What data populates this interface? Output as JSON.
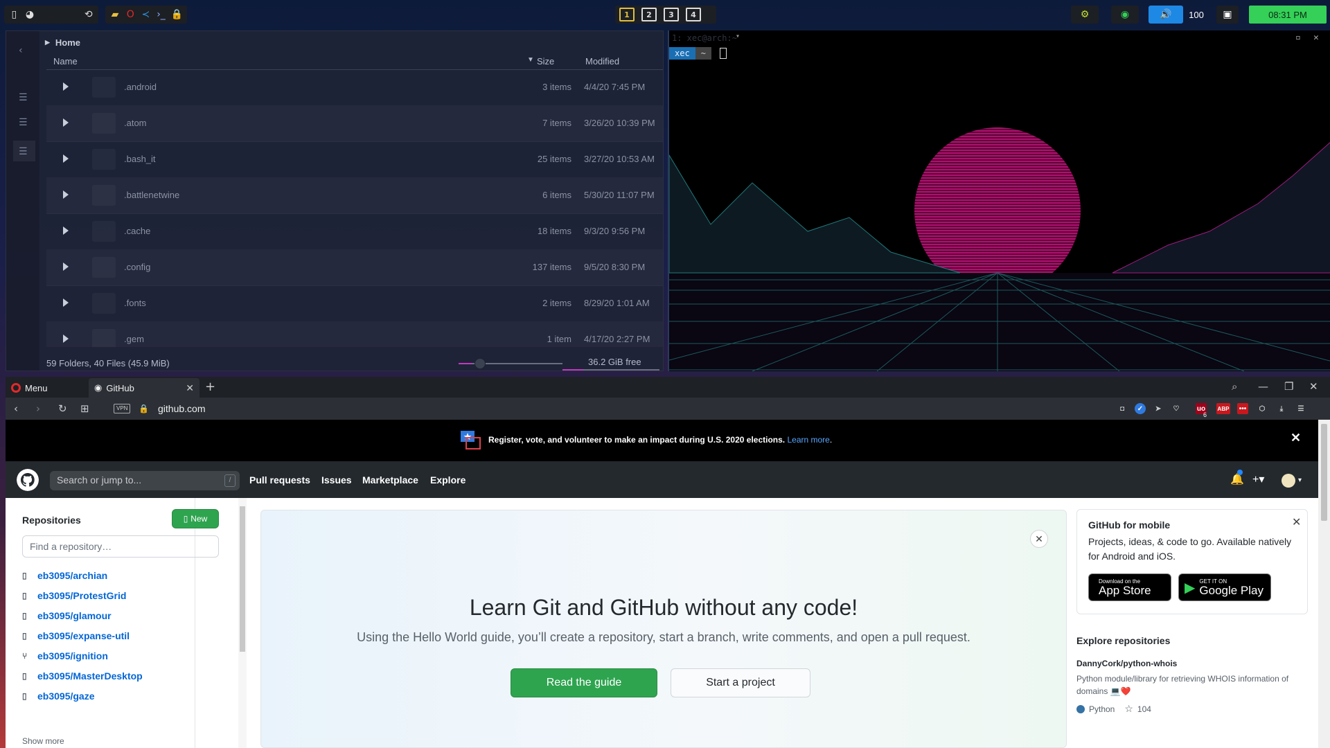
{
  "topbar": {
    "workspaces": [
      "1",
      "2",
      "3",
      "4"
    ],
    "volume": "100",
    "clock": "08:31 PM",
    "icons": [
      "notes-icon",
      "discord-icon",
      "sync-icon",
      "folder-icon",
      "opera-icon",
      "vscode-icon",
      "terminal-icon",
      "lock-icon",
      "cpu-icon",
      "gpu-icon",
      "volume-icon",
      "display-icon"
    ]
  },
  "file_manager": {
    "breadcrumb": "Home",
    "columns": {
      "name": "Name",
      "size": "Size",
      "modified": "Modified"
    },
    "rows": [
      {
        "name": ".android",
        "size": "3 items",
        "modified": "4/4/20 7:45 PM"
      },
      {
        "name": ".atom",
        "size": "7 items",
        "modified": "3/26/20 10:39 PM"
      },
      {
        "name": ".bash_it",
        "size": "25 items",
        "modified": "3/27/20 10:53 AM"
      },
      {
        "name": ".battlenetwine",
        "size": "6 items",
        "modified": "5/30/20 11:07 PM"
      },
      {
        "name": ".cache",
        "size": "18 items",
        "modified": "9/3/20 9:56 PM"
      },
      {
        "name": ".config",
        "size": "137 items",
        "modified": "9/5/20 8:30 PM"
      },
      {
        "name": ".fonts",
        "size": "2 items",
        "modified": "8/29/20 1:01 AM"
      },
      {
        "name": ".gem",
        "size": "1 item",
        "modified": "4/17/20 2:27 PM"
      }
    ],
    "status": "59 Folders, 40 Files (45.9 MiB)",
    "free_space": "36.2 GiB free"
  },
  "terminal": {
    "title": "1: xec@arch:~",
    "user": "xec",
    "dir": "~"
  },
  "browser": {
    "menu_label": "Menu",
    "tab_title": "GitHub",
    "url": "github.com",
    "vpn_label": "VPN",
    "ext_badge": "6",
    "ext_abp": "ABP"
  },
  "github": {
    "banner_text": "Register, vote, and volunteer to make an impact during U.S. 2020 elections.",
    "banner_link": "Learn more",
    "banner_period": ".",
    "search_placeholder": "Search or jump to...",
    "search_shortcut": "/",
    "nav": [
      "Pull requests",
      "Issues",
      "Marketplace",
      "Explore"
    ],
    "repositories_heading": "Repositories",
    "new_button": "New",
    "find_repo_placeholder": "Find a repository…",
    "repos": [
      {
        "name": "eb3095/archian",
        "icon": "repo-icon"
      },
      {
        "name": "eb3095/ProtestGrid",
        "icon": "repo-icon"
      },
      {
        "name": "eb3095/glamour",
        "icon": "repo-icon"
      },
      {
        "name": "eb3095/expanse-util",
        "icon": "repo-icon"
      },
      {
        "name": "eb3095/ignition",
        "icon": "fork-icon"
      },
      {
        "name": "eb3095/MasterDesktop",
        "icon": "repo-icon"
      },
      {
        "name": "eb3095/gaze",
        "icon": "repo-icon"
      }
    ],
    "show_more": "Show more",
    "hero_title": "Learn Git and GitHub without any code!",
    "hero_text": "Using the Hello World guide, you’ll create a repository, start a branch, write comments, and open a pull request.",
    "read_guide": "Read the guide",
    "start_project": "Start a project",
    "mobile_title": "GitHub for mobile",
    "mobile_desc": "Projects, ideas, & code to go. Available natively for Android and iOS.",
    "app_store_small": "Download on the",
    "app_store_big": "App Store",
    "google_play_small": "GET IT ON",
    "google_play_big": "Google Play",
    "explore_heading": "Explore repositories",
    "explore_repo": "DannyCork/python-whois",
    "explore_desc": "Python module/library for retrieving WHOIS information of domains 💻❤️",
    "explore_lang": "Python",
    "explore_stars": "104"
  }
}
